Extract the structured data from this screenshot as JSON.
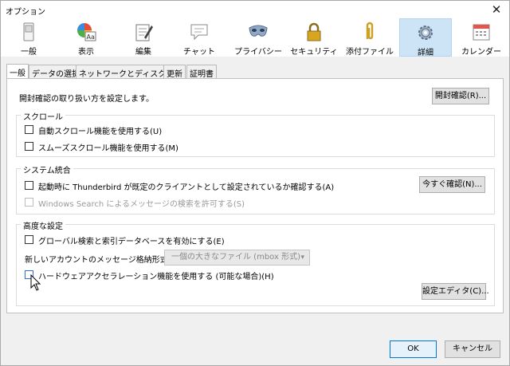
{
  "window": {
    "title": "オプション",
    "close_glyph": "✕"
  },
  "toolbar": {
    "items": [
      {
        "label": "一般",
        "icon": "general-switch-icon"
      },
      {
        "label": "表示",
        "icon": "display-palette-icon"
      },
      {
        "label": "編集",
        "icon": "compose-pen-icon"
      },
      {
        "label": "チャット",
        "icon": "chat-bubble-icon"
      },
      {
        "label": "プライバシー",
        "icon": "privacy-mask-icon"
      },
      {
        "label": "セキュリティ",
        "icon": "security-lock-icon"
      },
      {
        "label": "添付ファイル",
        "icon": "attachment-clip-icon"
      },
      {
        "label": "詳細",
        "icon": "advanced-gear-icon",
        "selected": true
      },
      {
        "label": "カレンダー",
        "icon": "calendar-icon"
      }
    ]
  },
  "tabs": [
    "一般",
    "データの選択",
    "ネットワークとディスク領域",
    "更新",
    "証明書"
  ],
  "general": {
    "receipt_desc": "開封確認の取り扱い方を設定します。",
    "receipt_button": "開封確認(R)..."
  },
  "scroll": {
    "title": "スクロール",
    "auto_scroll": "自動スクロール機能を使用する(U)",
    "smooth_scroll": "スムーズスクロール機能を使用する(M)"
  },
  "system": {
    "title": "システム統合",
    "default_check": "起動時に Thunderbird が既定のクライアントとして設定されているか確認する(A)",
    "check_now_button": "今すぐ確認(N)...",
    "windows_search": "Windows Search によるメッセージの検索を許可する(S)"
  },
  "advanced": {
    "title": "高度な設定",
    "global_search": "グローバル検索と索引データベースを有効にする(E)",
    "storage_label": "新しいアカウントのメッセージ格納形式(T):",
    "storage_value": "一個の大きなファイル (mbox 形式)",
    "hw_accel": "ハードウェアアクセラレーション機能を使用する (可能な場合)(H)",
    "config_editor_button": "設定エディタ(C)..."
  },
  "footer": {
    "ok": "OK",
    "cancel": "キャンセル"
  },
  "colors": {
    "selected_bg": "#cde4f7",
    "accent": "#0078d7"
  }
}
